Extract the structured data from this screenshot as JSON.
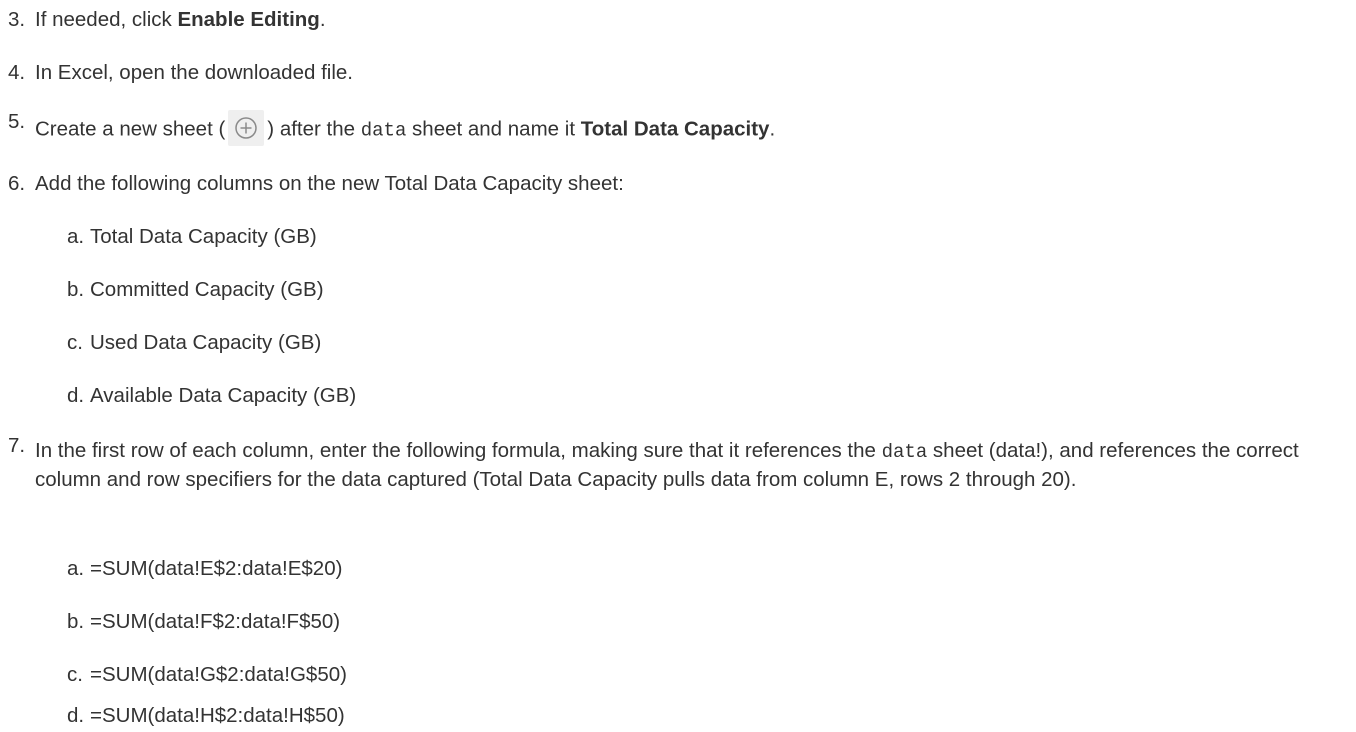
{
  "steps": [
    {
      "num": "3.",
      "pre": "If needed, click ",
      "bold": "Enable Editing",
      "post": "."
    },
    {
      "num": "4.",
      "text": "In Excel, open the downloaded file."
    },
    {
      "num": "5.",
      "pre": "Create a new sheet (",
      "icon": "add-sheet-plus-icon",
      "mid": ") after the ",
      "code": "data",
      "mid2": " sheet and name it ",
      "bold": "Total Data Capacity",
      "post": "."
    },
    {
      "num": "6.",
      "text": "Add the following columns on the new Total Data Capacity sheet:",
      "subitems": [
        {
          "letter": "a.",
          "text": "Total Data Capacity (GB)"
        },
        {
          "letter": "b.",
          "text": "Committed Capacity (GB)"
        },
        {
          "letter": "c.",
          "text": "Used Data Capacity (GB)"
        },
        {
          "letter": "d.",
          "text": "Available Data Capacity (GB)"
        }
      ]
    },
    {
      "num": "7.",
      "pre": "In the first row of each column, enter the following formula, making sure that it references the ",
      "code": "data",
      "post": " sheet (data!), and references the correct column and row specifiers for the data captured (Total Data Capacity pulls data from column E, rows 2 through 20).",
      "subitems": [
        {
          "letter": "a.",
          "text": "=SUM(data!E$2:data!E$20)"
        },
        {
          "letter": "b.",
          "text": "=SUM(data!F$2:data!F$50)"
        },
        {
          "letter": "c.",
          "text": "=SUM(data!G$2:data!G$50)"
        },
        {
          "letter": "d.",
          "text": "=SUM(data!H$2:data!H$50)"
        }
      ]
    }
  ]
}
